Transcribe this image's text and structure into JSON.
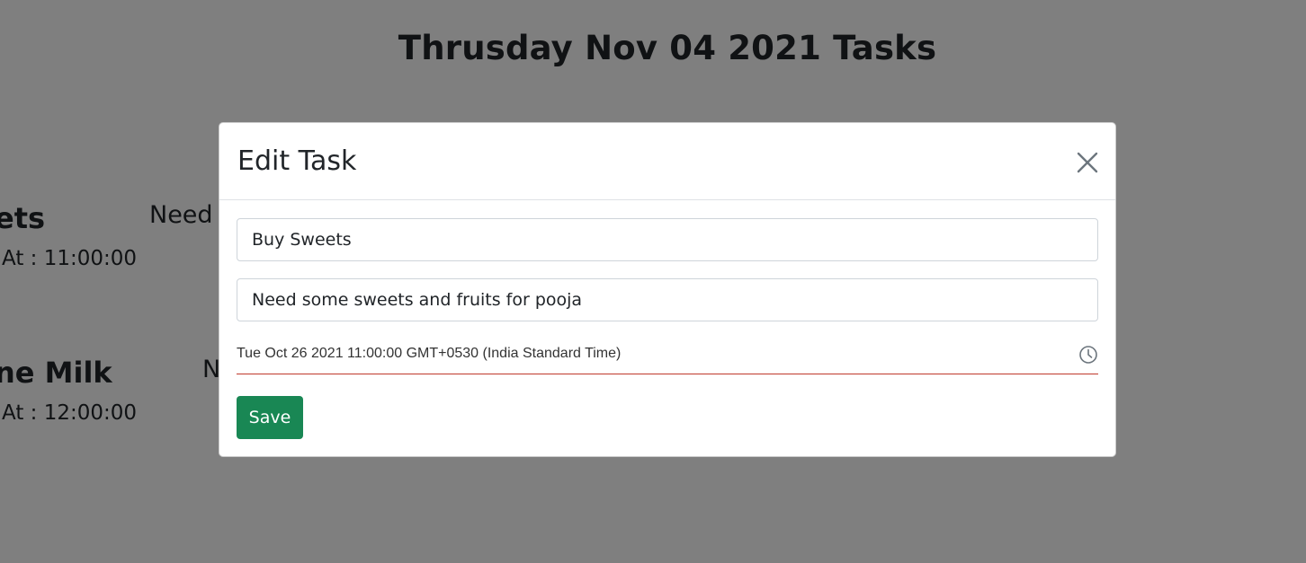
{
  "page": {
    "title": "Thrusday Nov 04 2021 Tasks"
  },
  "tasks": [
    {
      "title": "ets",
      "time": "At : 11:00:00",
      "description": "Need"
    },
    {
      "title": "ne Milk",
      "time": "At : 12:00:00",
      "description": "N"
    }
  ],
  "modal": {
    "title": "Edit Task",
    "close_icon": "close-icon",
    "task_name_value": "Buy Sweets",
    "task_description_value": "Need some sweets and fruits for pooja",
    "datetime_value": "Tue Oct 26 2021 11:00:00 GMT+0530 (India Standard Time)",
    "clock_icon": "clock-icon",
    "save_label": "Save"
  },
  "colors": {
    "backdrop": "#808080",
    "save_button": "#198754",
    "date_underline": "#c0392b"
  }
}
